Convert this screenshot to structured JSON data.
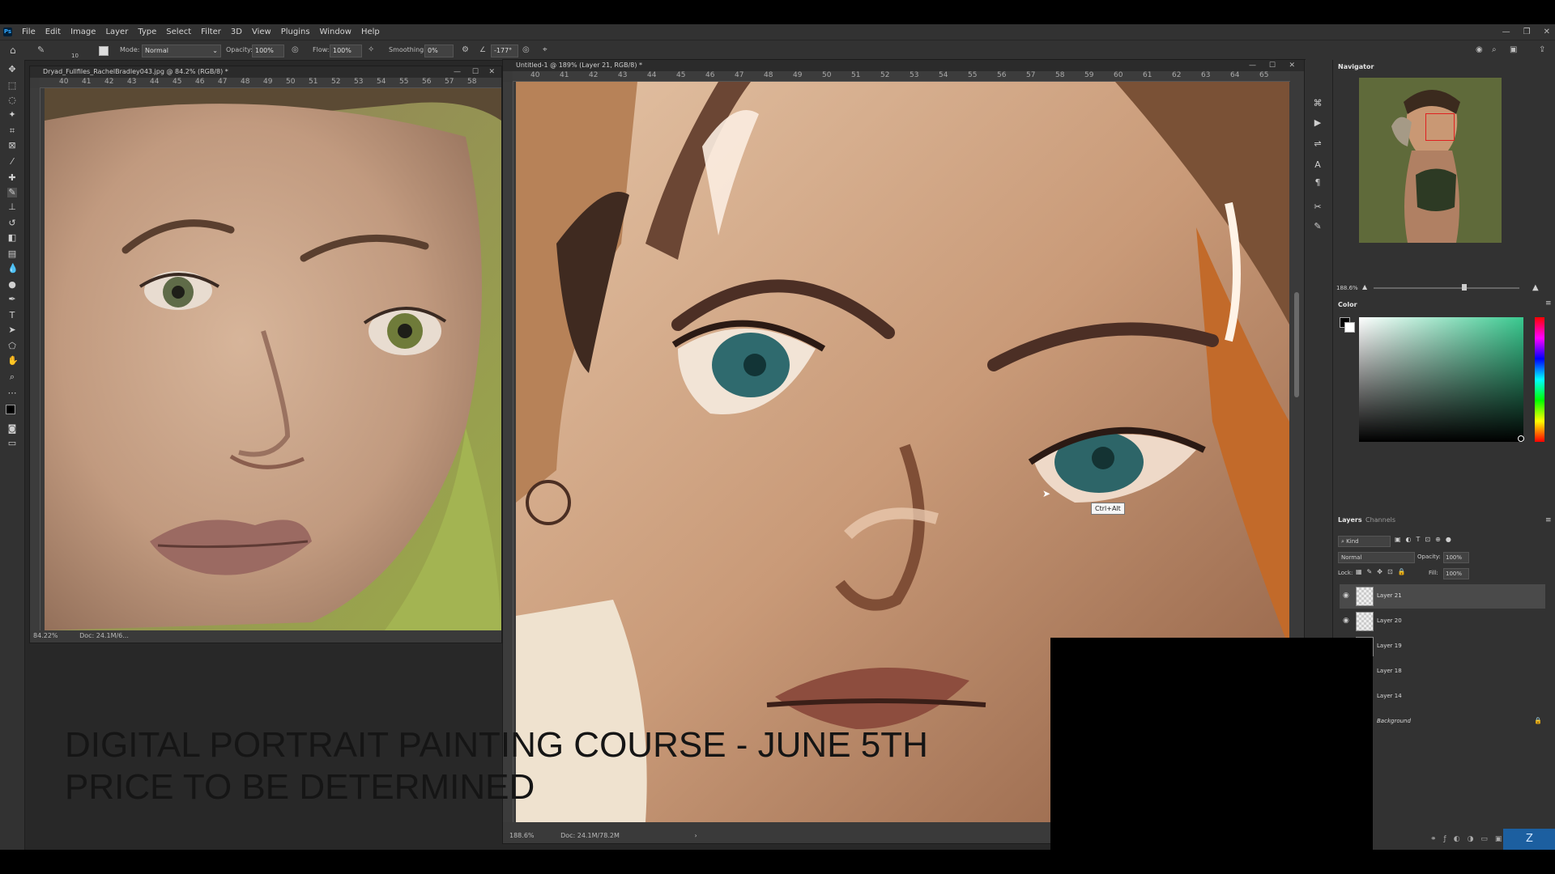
{
  "menubar": {
    "logo": "Ps",
    "items": [
      "File",
      "Edit",
      "Image",
      "Layer",
      "Type",
      "Select",
      "Filter",
      "3D",
      "View",
      "Plugins",
      "Window",
      "Help"
    ]
  },
  "options": {
    "brush_size": "10",
    "mode_label": "Mode:",
    "mode_value": "Normal",
    "opacity_label": "Opacity:",
    "opacity_value": "100%",
    "flow_label": "Flow:",
    "flow_value": "100%",
    "smoothing_label": "Smoothing:",
    "smoothing_value": "0%",
    "angle_value": "-177°"
  },
  "doc1": {
    "title": "Dryad_Fullfiles_RachelBradley043.jpg @ 84.2% (RGB/8) *",
    "ruler": [
      "40",
      "41",
      "42",
      "43",
      "44",
      "45",
      "46",
      "47",
      "48",
      "49",
      "50",
      "51",
      "52",
      "53",
      "54",
      "55",
      "56",
      "57",
      "58"
    ],
    "zoom": "84.22%",
    "doc_info": "Doc: 24.1M/6..."
  },
  "doc2": {
    "title": "Untitled-1 @ 189% (Layer 21, RGB/8) *",
    "ruler": [
      "40",
      "41",
      "42",
      "43",
      "44",
      "45",
      "46",
      "47",
      "48",
      "49",
      "50",
      "51",
      "52",
      "53",
      "54",
      "55",
      "56",
      "57",
      "58",
      "59",
      "60",
      "61",
      "62",
      "63",
      "64",
      "65"
    ],
    "zoom": "188.6%",
    "doc_info": "Doc: 24.1M/78.2M",
    "tooltip": "Ctrl+Alt"
  },
  "overlay": {
    "line1": "DIGITAL PORTRAIT PAINTING COURSE - JUNE 5TH",
    "line2": "PRICE TO BE DETERMINED"
  },
  "navigator": {
    "tab": "Navigator",
    "zoom": "188.6%",
    "zoom_level": 0.62
  },
  "color_panel": {
    "tab": "Color",
    "hue_color": "#39c98f"
  },
  "layers_panel": {
    "tab_layers": "Layers",
    "tab_channels": "Channels",
    "filter": "Kind",
    "blend_mode": "Normal",
    "opacity_label": "Opacity:",
    "opacity_value": "100%",
    "lock_label": "Lock:",
    "fill_label": "Fill:",
    "fill_value": "100%",
    "layers": [
      {
        "name": "Layer 21",
        "visible": true,
        "selected": true
      },
      {
        "name": "Layer 20",
        "visible": true
      },
      {
        "name": "Layer 19",
        "visible": true
      },
      {
        "name": "Layer 18",
        "visible": false
      },
      {
        "name": "Layer 14",
        "visible": false
      },
      {
        "name": "Background",
        "visible": false,
        "locked": true
      }
    ]
  },
  "colors": {
    "accent": "#31a8ff",
    "ui_dark": "#282828",
    "panel": "#323232"
  }
}
